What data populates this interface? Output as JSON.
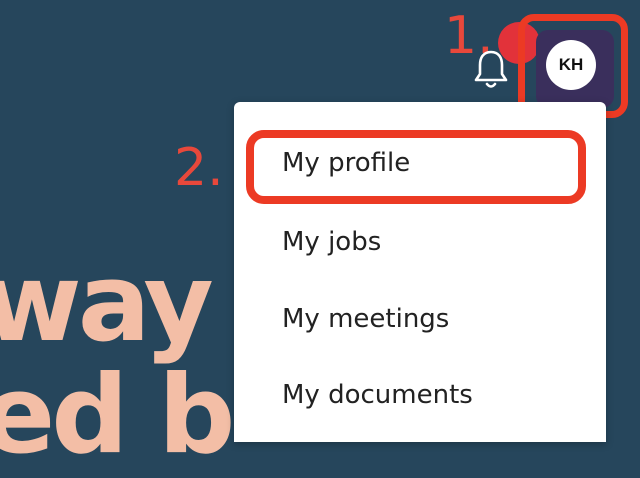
{
  "hero": {
    "line1": "way",
    "line2": "ed b"
  },
  "header": {
    "notification_icon": "bell-icon",
    "avatar_initials": "KH"
  },
  "annotations": {
    "step1": "1.",
    "step2": "2.",
    "highlight_color": "#ec3a24"
  },
  "menu": {
    "items": [
      {
        "label": "My profile"
      },
      {
        "label": "My jobs"
      },
      {
        "label": "My meetings"
      },
      {
        "label": "My documents"
      }
    ]
  },
  "colors": {
    "background": "#26465c",
    "hero_text": "#f3bea6",
    "badge": "#e2323a",
    "avatar_bg": "#ffffff"
  }
}
